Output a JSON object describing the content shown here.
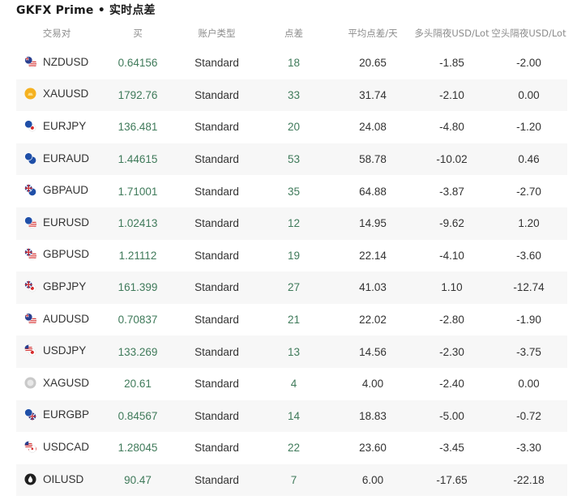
{
  "page": {
    "title": "GKFX Prime • 实时点差"
  },
  "table": {
    "headers": [
      "交易对",
      "买",
      "账户类型",
      "点差",
      "平均点差/天",
      "多头隔夜USD/Lot",
      "空头隔夜USD/Lot"
    ],
    "rows": [
      {
        "pair": "NZDUSD",
        "icon": "nz-us-flag-icon",
        "bid": "0.64156",
        "account": "Standard",
        "spread": "18",
        "avg": "20.65",
        "long": "-1.85",
        "short": "-2.00"
      },
      {
        "pair": "XAUUSD",
        "icon": "gold-coin-icon",
        "bid": "1792.76",
        "account": "Standard",
        "spread": "33",
        "avg": "31.74",
        "long": "-2.10",
        "short": "0.00"
      },
      {
        "pair": "EURJPY",
        "icon": "eu-jp-flag-icon",
        "bid": "136.481",
        "account": "Standard",
        "spread": "20",
        "avg": "24.08",
        "long": "-4.80",
        "short": "-1.20"
      },
      {
        "pair": "EURAUD",
        "icon": "eu-au-flag-icon",
        "bid": "1.44615",
        "account": "Standard",
        "spread": "53",
        "avg": "58.78",
        "long": "-10.02",
        "short": "0.46"
      },
      {
        "pair": "GBPAUD",
        "icon": "gb-au-flag-icon",
        "bid": "1.71001",
        "account": "Standard",
        "spread": "35",
        "avg": "64.88",
        "long": "-3.87",
        "short": "-2.70"
      },
      {
        "pair": "EURUSD",
        "icon": "eu-us-flag-icon",
        "bid": "1.02413",
        "account": "Standard",
        "spread": "12",
        "avg": "14.95",
        "long": "-9.62",
        "short": "1.20"
      },
      {
        "pair": "GBPUSD",
        "icon": "gb-us-flag-icon",
        "bid": "1.21112",
        "account": "Standard",
        "spread": "19",
        "avg": "22.14",
        "long": "-4.10",
        "short": "-3.60"
      },
      {
        "pair": "GBPJPY",
        "icon": "gb-jp-flag-icon",
        "bid": "161.399",
        "account": "Standard",
        "spread": "27",
        "avg": "41.03",
        "long": "1.10",
        "short": "-12.74"
      },
      {
        "pair": "AUDUSD",
        "icon": "au-us-flag-icon",
        "bid": "0.70837",
        "account": "Standard",
        "spread": "21",
        "avg": "22.02",
        "long": "-2.80",
        "short": "-1.90"
      },
      {
        "pair": "USDJPY",
        "icon": "us-jp-flag-icon",
        "bid": "133.269",
        "account": "Standard",
        "spread": "13",
        "avg": "14.56",
        "long": "-2.30",
        "short": "-3.75"
      },
      {
        "pair": "XAGUSD",
        "icon": "silver-coin-icon",
        "bid": "20.61",
        "account": "Standard",
        "spread": "4",
        "avg": "4.00",
        "long": "-2.40",
        "short": "0.00"
      },
      {
        "pair": "EURGBP",
        "icon": "eu-gb-flag-icon",
        "bid": "0.84567",
        "account": "Standard",
        "spread": "14",
        "avg": "18.83",
        "long": "-5.00",
        "short": "-0.72"
      },
      {
        "pair": "USDCAD",
        "icon": "us-ca-flag-icon",
        "bid": "1.28045",
        "account": "Standard",
        "spread": "22",
        "avg": "23.60",
        "long": "-3.45",
        "short": "-3.30"
      },
      {
        "pair": "OILUSD",
        "icon": "oil-drop-icon",
        "bid": "90.47",
        "account": "Standard",
        "spread": "7",
        "avg": "6.00",
        "long": "-17.65",
        "short": "-22.18"
      }
    ]
  },
  "colors": {
    "accent_green": "#3f7a5a",
    "row_stripe": "#f7f7f7",
    "header_text": "#8c8c8c"
  }
}
